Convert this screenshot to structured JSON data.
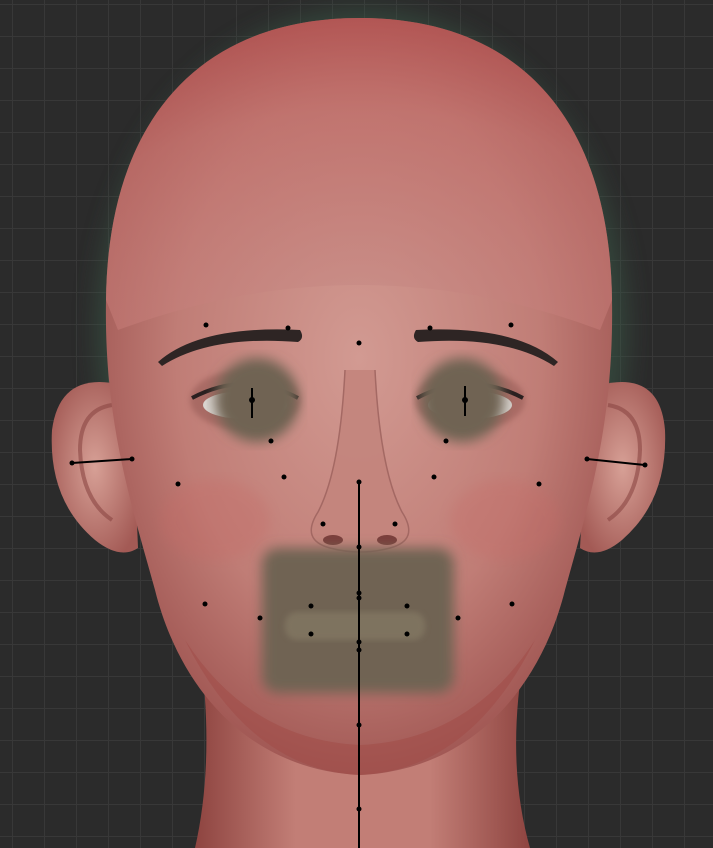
{
  "viewport": {
    "grid_color": "#383838",
    "background_color": "#2b2b2b"
  },
  "model": {
    "skin_tone": "#c9857e",
    "skin_shadow": "#a85a55",
    "scalp_tint": "#c65e5e",
    "mask_color": "#6f6452",
    "landmark_color": "#000000",
    "rim_glow": "#3a5c4a"
  }
}
